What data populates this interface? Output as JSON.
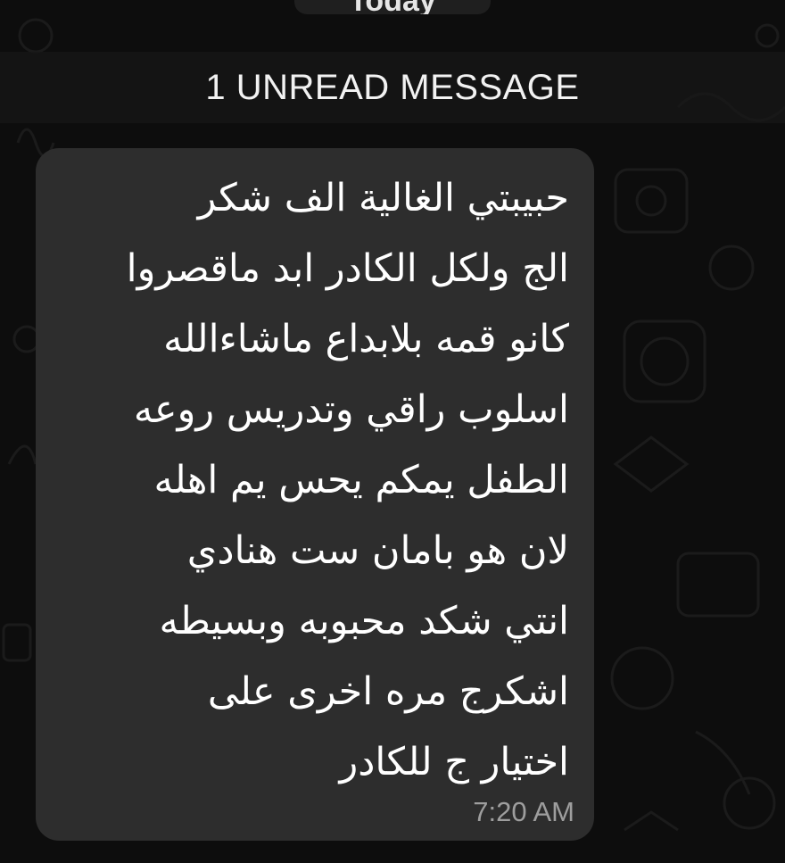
{
  "chat": {
    "date_label": "Today",
    "unread_banner": "1 UNREAD MESSAGE",
    "message": {
      "lines": [
        "حبيبتي  الغالية  الف شكر",
        "الج ولكل الكادر ابد ماقصروا",
        "كانو قمه بلابداع ماشاءالله",
        "اسلوب راقي وتدريس روعه",
        "الطفل يمكم  يحس يم اهله",
        "لان هو بامان  ست هنادي",
        "انتي شكد محبوبه وبسيطه",
        "اشكرج مره اخرى على",
        "اختيار ج للكادر"
      ],
      "time": "7:20 AM"
    }
  },
  "colors": {
    "background": "#0d0d0d",
    "bubble": "#2d2d2d",
    "text": "#ffffff",
    "timestamp": "#9e9e9e"
  }
}
